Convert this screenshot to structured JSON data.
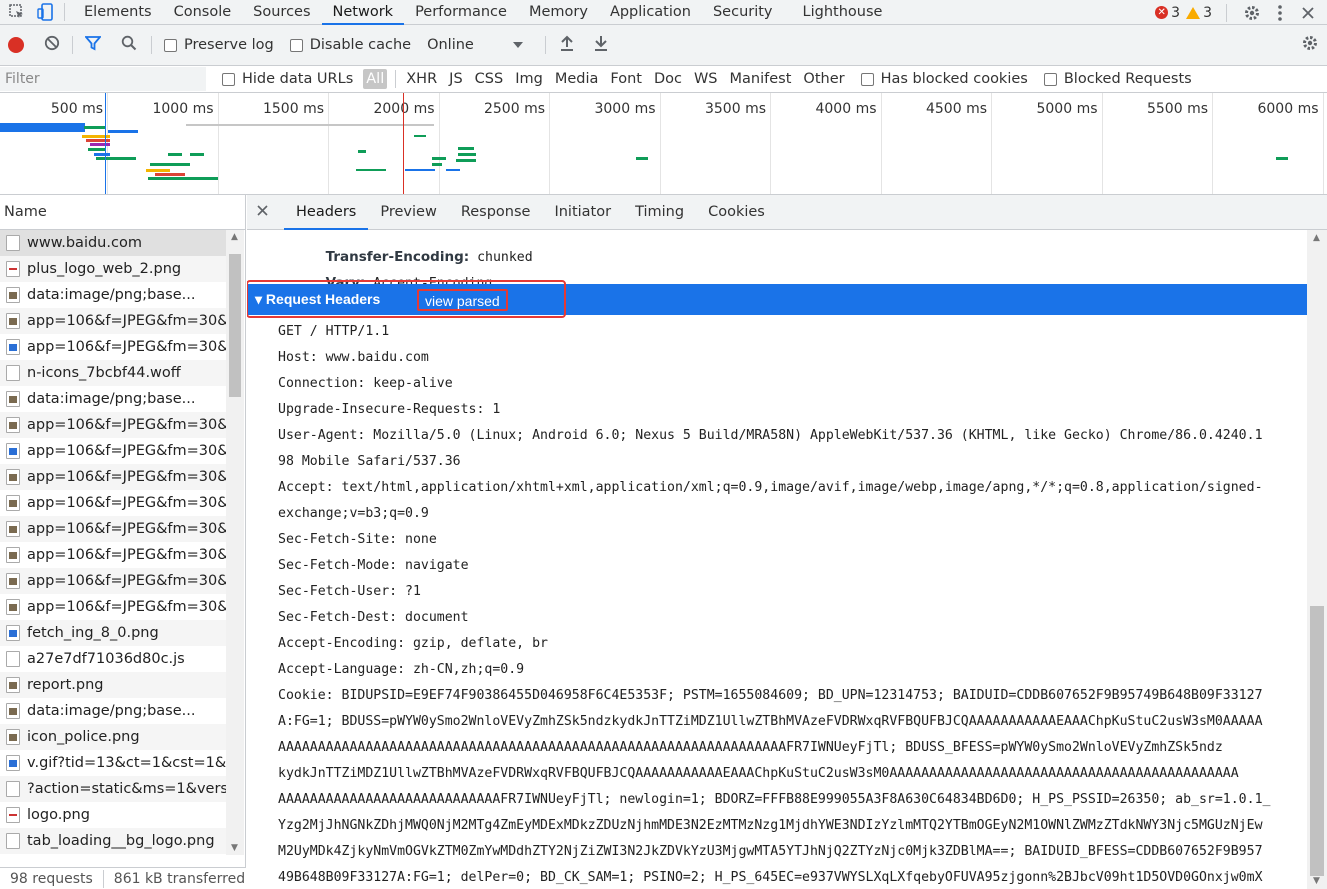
{
  "tabs": [
    "Elements",
    "Console",
    "Sources",
    "Network",
    "Performance",
    "Memory",
    "Application",
    "Security",
    "Lighthouse"
  ],
  "active_tab": "Network",
  "issues": {
    "errors": "3",
    "warnings": "3"
  },
  "toolbar": {
    "preserve_log": "Preserve log",
    "disable_cache": "Disable cache",
    "throttle": "Online"
  },
  "filterbar": {
    "placeholder": "Filter",
    "hide_data_urls": "Hide data URLs",
    "types": [
      "All",
      "XHR",
      "JS",
      "CSS",
      "Img",
      "Media",
      "Font",
      "Doc",
      "WS",
      "Manifest",
      "Other"
    ],
    "has_blocked_cookies": "Has blocked cookies",
    "blocked_requests": "Blocked Requests"
  },
  "overview": {
    "tick_labels": [
      "500 ms",
      "1000 ms",
      "1500 ms",
      "2000 ms",
      "2500 ms",
      "3000 ms",
      "3500 ms",
      "4000 ms",
      "4500 ms",
      "5000 ms",
      "5500 ms",
      "6000 ms"
    ]
  },
  "name_header": "Name",
  "requests": [
    {
      "name": "www.baidu.com",
      "icon": "document-icon"
    },
    {
      "name": "plus_logo_web_2.png",
      "icon": "png-icon"
    },
    {
      "name": "data:image/png;base...",
      "icon": "image-icon"
    },
    {
      "name": "app=106&f=JPEG&fm=30&f...",
      "icon": "image-icon"
    },
    {
      "name": "app=106&f=JPEG&fm=30&f...",
      "icon": "image-blue-icon"
    },
    {
      "name": "n-icons_7bcbf44.woff",
      "icon": "document-icon"
    },
    {
      "name": "data:image/png;base...",
      "icon": "image-icon"
    },
    {
      "name": "app=106&f=JPEG&fm=30&f...",
      "icon": "image-icon"
    },
    {
      "name": "app=106&f=JPEG&fm=30&f...",
      "icon": "image-blue-icon"
    },
    {
      "name": "app=106&f=JPEG&fm=30&f...",
      "icon": "image-icon"
    },
    {
      "name": "app=106&f=JPEG&fm=30&f...",
      "icon": "image-icon"
    },
    {
      "name": "app=106&f=JPEG&fm=30&f...",
      "icon": "image-icon"
    },
    {
      "name": "app=106&f=JPEG&fm=30&f...",
      "icon": "image-icon"
    },
    {
      "name": "app=106&f=JPEG&fm=30&f...",
      "icon": "image-icon"
    },
    {
      "name": "app=106&f=JPEG&fm=30&f...",
      "icon": "image-icon"
    },
    {
      "name": "fetch_ing_8_0.png",
      "icon": "image-blue-icon"
    },
    {
      "name": "a27e7df71036d80c.js",
      "icon": "document-icon"
    },
    {
      "name": "report.png",
      "icon": "image-icon"
    },
    {
      "name": "data:image/png;base...",
      "icon": "image-icon"
    },
    {
      "name": "icon_police.png",
      "icon": "image-icon"
    },
    {
      "name": "v.gif?tid=13&ct=1&cst=1&lo...",
      "icon": "image-blue-icon"
    },
    {
      "name": "?action=static&ms=1&versio...",
      "icon": "document-icon"
    },
    {
      "name": "logo.png",
      "icon": "png-icon"
    },
    {
      "name": "tab_loading__bg_logo.png",
      "icon": "document-icon"
    }
  ],
  "status": {
    "requests": "98 requests",
    "transferred": "861 kB transferred"
  },
  "detail_tabs": [
    "Headers",
    "Preview",
    "Response",
    "Initiator",
    "Timing",
    "Cookies"
  ],
  "active_detail_tab": "Headers",
  "response_headers_tail": [
    {
      "key": "Transfer-Encoding:",
      "value": "chunked"
    },
    {
      "key": "Vary:",
      "value": "Accept-Encoding"
    }
  ],
  "request_section": {
    "title": "▾ Request Headers",
    "view_parsed": "view parsed"
  },
  "request_lines": [
    "GET / HTTP/1.1",
    "Host: www.baidu.com",
    "Connection: keep-alive",
    "Upgrade-Insecure-Requests: 1",
    "User-Agent: Mozilla/5.0 (Linux; Android 6.0; Nexus 5 Build/MRA58N) AppleWebKit/537.36 (KHTML, like Gecko) Chrome/86.0.4240.1",
    "98 Mobile Safari/537.36",
    "Accept: text/html,application/xhtml+xml,application/xml;q=0.9,image/avif,image/webp,image/apng,*/*;q=0.8,application/signed-",
    "exchange;v=b3;q=0.9",
    "Sec-Fetch-Site: none",
    "Sec-Fetch-Mode: navigate",
    "Sec-Fetch-User: ?1",
    "Sec-Fetch-Dest: document",
    "Accept-Encoding: gzip, deflate, br",
    "Accept-Language: zh-CN,zh;q=0.9",
    "Cookie: BIDUPSID=E9EF74F90386455D046958F6C4E5353F; PSTM=1655084609; BD_UPN=12314753; BAIDUID=CDDB607652F9B95749B648B09F33127",
    "A:FG=1; BDUSS=pWYW0ySmo2WnloVEVyZmhZSk5ndzkydkJnTTZiMDZ1UllwZTBhMVAzeFVDRWxqRVFBQUFBJCQAAAAAAAAAAAEAAAChpKuStuC2usW3sM0AAAAA",
    "AAAAAAAAAAAAAAAAAAAAAAAAAAAAAAAAAAAAAAAAAAAAAAAAAAAAAAAAAAAAAAAAFR7IWNUeyFjTl; BDUSS_BFESS=pWYW0ySmo2WnloVEVyZmhZSk5ndz",
    "kydkJnTTZiMDZ1UllwZTBhMVAzeFVDRWxqRVFBQUFBJCQAAAAAAAAAAAEAAAChpKuStuC2usW3sM0AAAAAAAAAAAAAAAAAAAAAAAAAAAAAAAAAAAAAAAAAAAA",
    "AAAAAAAAAAAAAAAAAAAAAAAAAAAAFR7IWNUeyFjTl; newlogin=1; BDORZ=FFFB88E999055A3F8A630C64834BD6D0; H_PS_PSSID=26350; ab_sr=1.0.1_",
    "Yzg2MjJhNGNkZDhjMWQ0NjM2MTg4ZmEyMDExMDkzZDUzNjhmMDE3N2EzMTMzNzg1MjdhYWE3NDIzYzlmMTQ2YTBmOGEyN2M1OWNlZWMzZTdkNWY3Njc5MGUzNjEw",
    "M2UyMDk4ZjkyNmVmOGVkZTM0ZmYwMDdhZTY2NjZiZWI3N2JkZDVkYzU3MjgwMTA5YTJhNjQ2ZTYzNjc0Mjk3ZDBlMA==; BAIDUID_BFESS=CDDB607652F9B957",
    "49B648B09F33127A:FG=1; delPer=0; BD_CK_SAM=1; PSINO=2; H_PS_645EC=e937VWYSLXqLXfqebyOFUVA95zjgonn%2BJbcV09ht1D5OVD0GOnxjw0mX"
  ]
}
